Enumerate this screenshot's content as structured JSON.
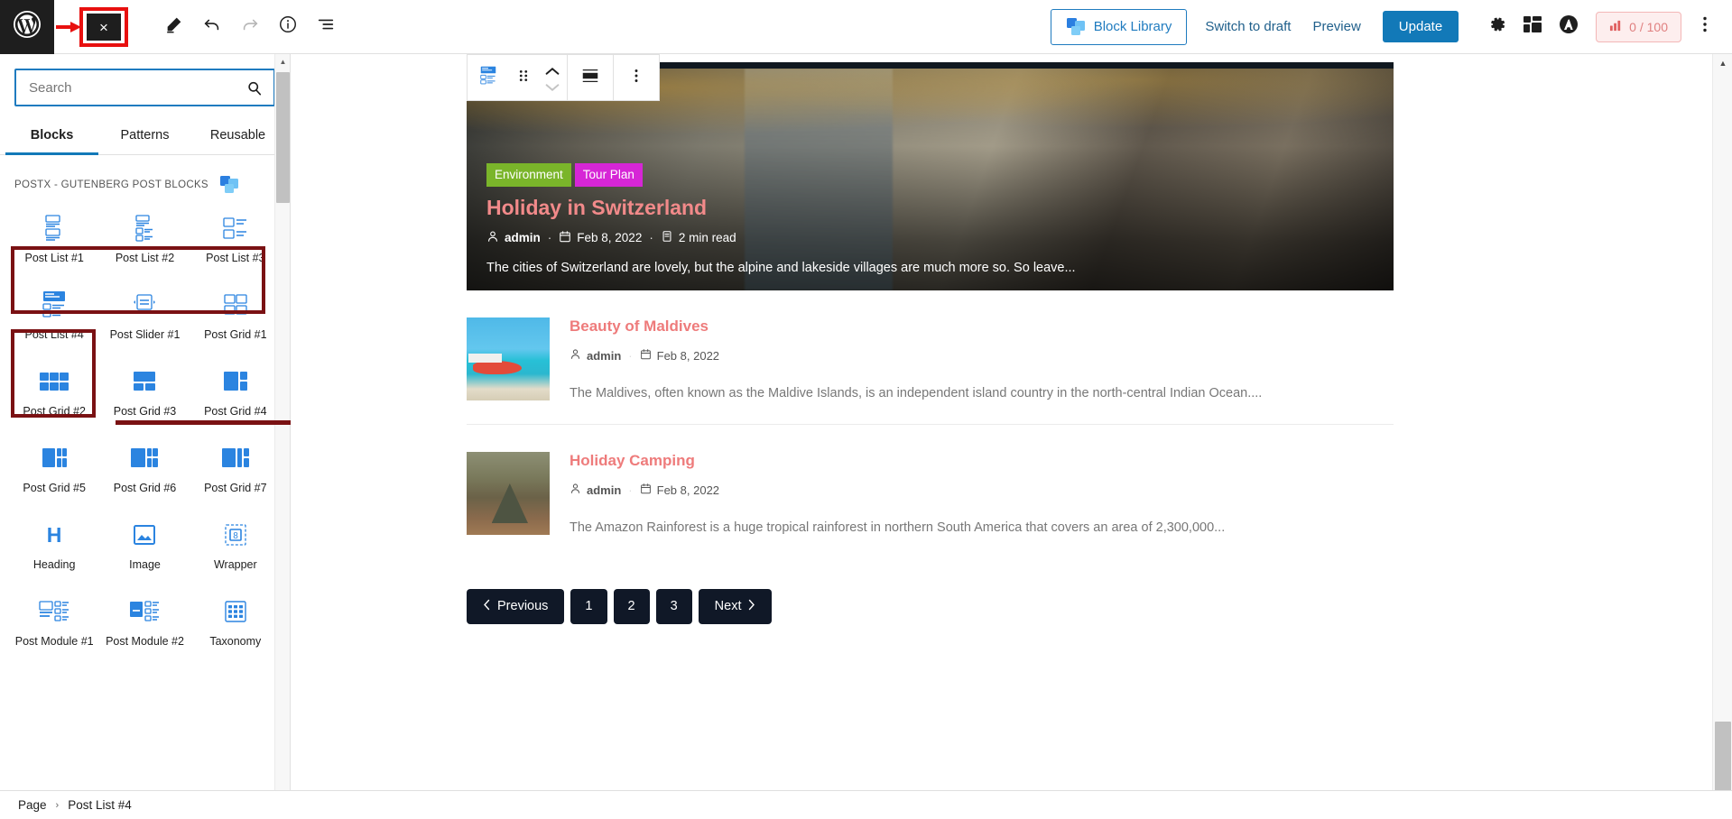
{
  "topbar": {
    "logo_icon": "wordpress-logo-icon",
    "close_label": "×",
    "edit_icon": "pencil-icon",
    "undo_icon": "undo-icon",
    "redo_icon": "redo-icon",
    "info_icon": "info-icon",
    "list_view_icon": "list-view-icon",
    "block_library_label": "Block Library",
    "switch_to_draft_label": "Switch to draft",
    "preview_label": "Preview",
    "update_label": "Update",
    "settings_icon": "gear-icon",
    "blocks_icon": "blocks-icon",
    "plugin_icon": "astra-icon",
    "seo_score": "0 / 100",
    "seo_icon": "seo-signal-icon",
    "more_icon": "kebab-menu-icon",
    "accent_blue": "#1279b8",
    "seo_color": "#e08080"
  },
  "sidebar": {
    "search": {
      "value": "",
      "placeholder": "Search",
      "icon": "search-icon"
    },
    "tabs": [
      {
        "label": "Blocks",
        "active": true
      },
      {
        "label": "Patterns",
        "active": false
      },
      {
        "label": "Reusable",
        "active": false
      }
    ],
    "category": {
      "label": "POSTX - GUTENBERG POST BLOCKS",
      "icon": "postx-logo-icon"
    },
    "blocks": [
      {
        "label": "Post List #1",
        "icon": "post-list-1-icon"
      },
      {
        "label": "Post List #2",
        "icon": "post-list-2-icon"
      },
      {
        "label": "Post List #3",
        "icon": "post-list-3-icon"
      },
      {
        "label": "Post List #4",
        "icon": "post-list-4-icon"
      },
      {
        "label": "Post Slider #1",
        "icon": "post-slider-1-icon"
      },
      {
        "label": "Post Grid #1",
        "icon": "post-grid-1-icon"
      },
      {
        "label": "Post Grid #2",
        "icon": "post-grid-2-icon"
      },
      {
        "label": "Post Grid #3",
        "icon": "post-grid-3-icon"
      },
      {
        "label": "Post Grid #4",
        "icon": "post-grid-4-icon"
      },
      {
        "label": "Post Grid #5",
        "icon": "post-grid-5-icon"
      },
      {
        "label": "Post Grid #6",
        "icon": "post-grid-6-icon"
      },
      {
        "label": "Post Grid #7",
        "icon": "post-grid-7-icon"
      },
      {
        "label": "Heading",
        "icon": "heading-icon"
      },
      {
        "label": "Image",
        "icon": "image-icon"
      },
      {
        "label": "Wrapper",
        "icon": "wrapper-icon"
      },
      {
        "label": "Post Module #1",
        "icon": "post-module-1-icon"
      },
      {
        "label": "Post Module #2",
        "icon": "post-module-2-icon"
      },
      {
        "label": "Taxonomy",
        "icon": "taxonomy-icon"
      }
    ],
    "annotation_color": "#7a1113"
  },
  "block_toolbar": {
    "block_type_icon": "post-list-4-icon",
    "drag_icon": "drag-handle-icon",
    "move_up_icon": "chevron-up-icon",
    "move_down_icon": "chevron-down-icon",
    "align_icon": "align-full-width-icon",
    "options_icon": "kebab-menu-icon"
  },
  "canvas": {
    "hero": {
      "terms": [
        {
          "label": "Environment",
          "color": "#7ab52a"
        },
        {
          "label": "Tour Plan",
          "color": "#d626d6"
        }
      ],
      "title": "Holiday in Switzerland",
      "author": "admin",
      "date": "Feb 8, 2022",
      "read_time": "2 min read",
      "excerpt": "The cities of Switzerland are lovely, but the alpine and lakeside villages are much more so. So leave...",
      "title_color": "#f28a8a",
      "author_icon": "user-icon",
      "date_icon": "calendar-icon",
      "read_icon": "read-time-icon"
    },
    "posts": [
      {
        "title": "Beauty of Maldives",
        "author": "admin",
        "date": "Feb 8, 2022",
        "excerpt": "The Maldives, often known as the Maldive Islands, is an independent island country in the north-central Indian Ocean....",
        "thumb": "maldives-thumbnail"
      },
      {
        "title": "Holiday Camping",
        "author": "admin",
        "date": "Feb 8, 2022",
        "excerpt": "The Amazon Rainforest is a huge tropical rainforest in northern South America that covers an area of 2,300,000...",
        "thumb": "camping-thumbnail"
      }
    ],
    "pagination": {
      "previous_label": "Previous",
      "next_label": "Next",
      "pages": [
        "1",
        "2",
        "3"
      ],
      "prev_icon": "chevron-left-icon",
      "next_icon": "chevron-right-icon"
    }
  },
  "breadcrumb": {
    "root": "Page",
    "separator": "›",
    "current": "Post List #4"
  }
}
